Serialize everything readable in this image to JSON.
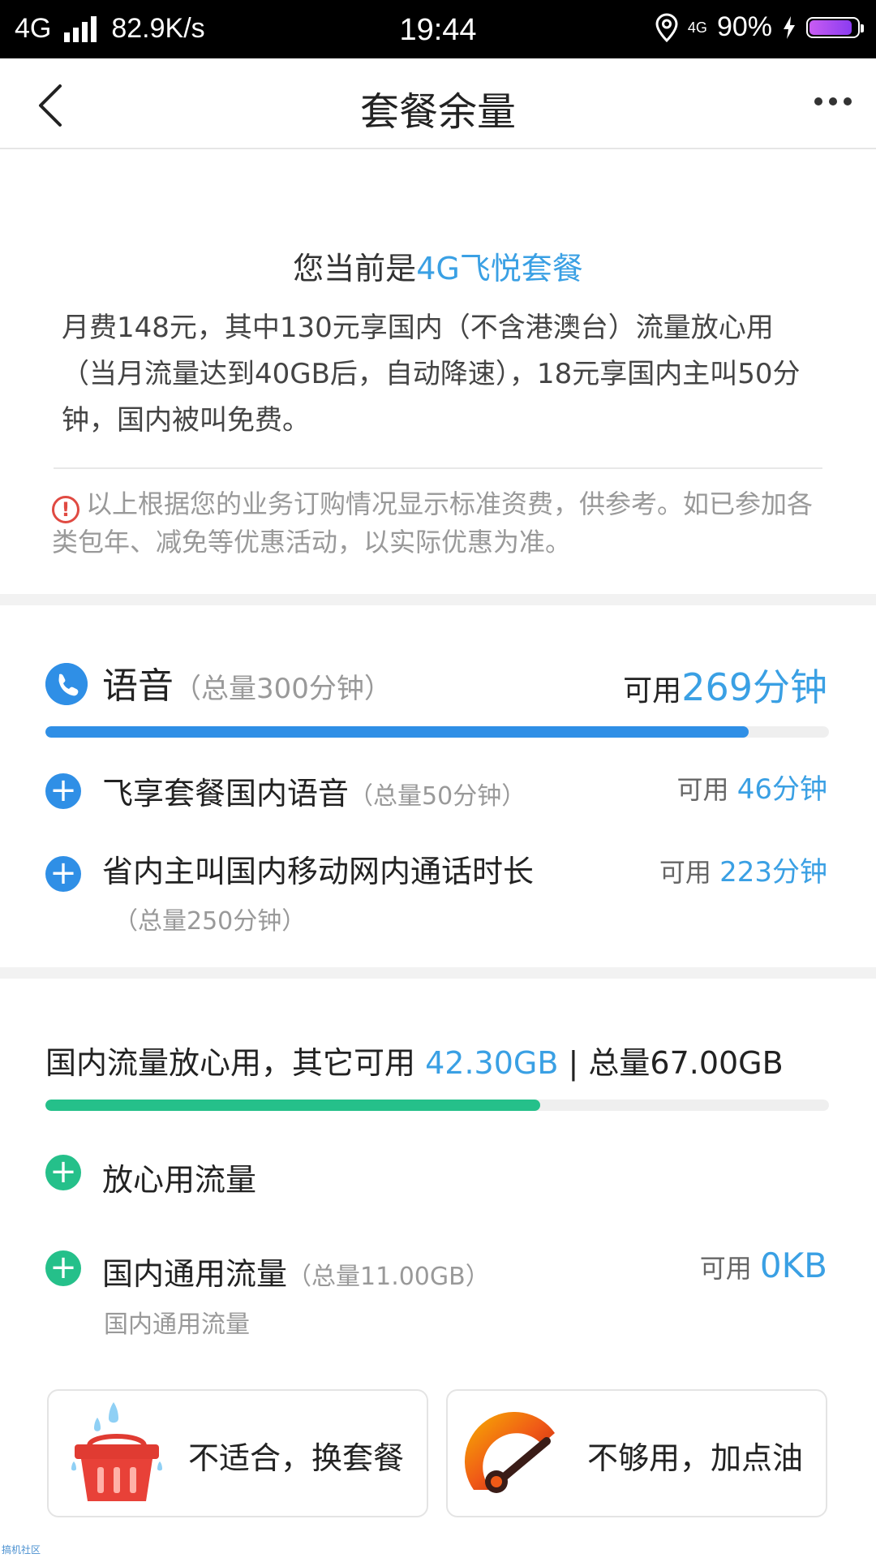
{
  "status_bar": {
    "network": "4G",
    "speed": "82.9K/s",
    "time": "19:44",
    "network_right": "4G",
    "battery": "90%"
  },
  "nav": {
    "title": "套餐余量"
  },
  "plan": {
    "prefix": "您当前是",
    "name": "4G飞悦套餐",
    "description": "月费148元，其中130元享国内（不含港澳台）流量放心用（当月流量达到40GB后，自动降速），18元享国内主叫50分钟，国内被叫免费。",
    "note": "以上根据您的业务订购情况显示标准资费，供参考。如已参加各类包年、减免等优惠活动，以实际优惠为准。"
  },
  "voice": {
    "title": "语音",
    "total": "（总量300分钟）",
    "avail_label": "可用",
    "avail_value": "269分钟",
    "progress": 0.897,
    "color": "#2f8fe6",
    "items": [
      {
        "name": "飞享套餐国内语音",
        "total": "（总量50分钟）",
        "avail_label": "可用",
        "avail_value": "46分钟"
      },
      {
        "name": "省内主叫国内移动网内通话时长",
        "total": "（总量250分钟）",
        "avail_label": "可用",
        "avail_value": "223分钟"
      }
    ]
  },
  "data": {
    "prefix": "国内流量放心用，其它可用",
    "available": "42.30GB",
    "suffix": "| 总量67.00GB",
    "progress": 0.631,
    "color": "#25c08a",
    "items": [
      {
        "name": "放心用流量"
      },
      {
        "name": "国内通用流量",
        "total": "（总量11.00GB）",
        "sub": "国内通用流量",
        "avail_label": "可用",
        "avail_value": "0KB"
      }
    ]
  },
  "actions": {
    "change_plan": "不适合，换套餐",
    "add_data": "不够用，加点油"
  },
  "watermark": "搞机社区"
}
